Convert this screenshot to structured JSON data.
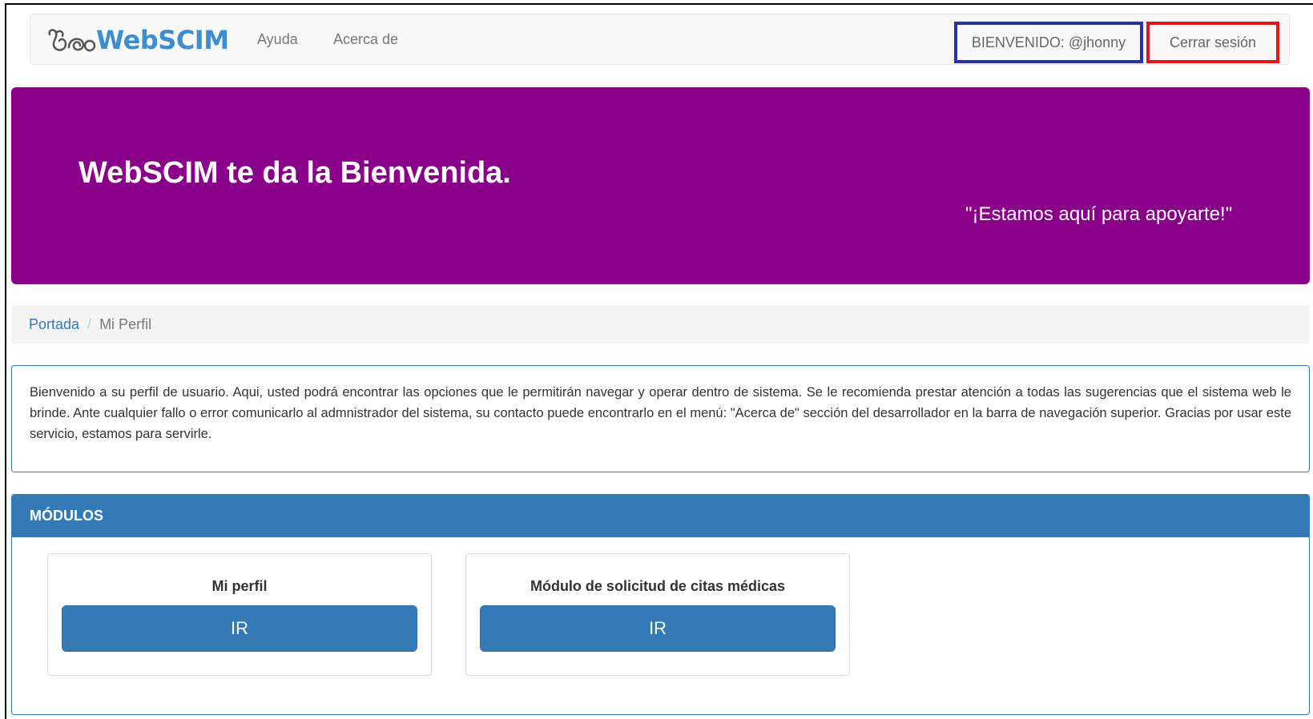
{
  "navbar": {
    "brand": "WebSCIM",
    "brand_icon": "stethoscope-logo-icon",
    "links": [
      "Ayuda",
      "Acerca de"
    ],
    "welcome_text": "BIENVENIDO: @jhonny",
    "logout_label": "Cerrar sesión"
  },
  "jumbotron": {
    "title": "WebSCIM te da la Bienvenida.",
    "subtitle": "\"¡Estamos aquí para apoyarte!\"",
    "background_color": "#8b008b"
  },
  "breadcrumb": {
    "home": "Portada",
    "separator": "/",
    "current": "Mi Perfil"
  },
  "info": {
    "text": "Bienvenido a su perfil de usuario. Aqui, usted podrá encontrar las opciones que le permitirán navegar y operar dentro de sistema. Se le recomienda prestar atención a todas las sugerencias que el sistema web le brinde. Ante cualquier fallo o error comunicarlo al admnistrador del sistema, su contacto puede encontrarlo en el menú: \"Acerca de\" sección del desarrollador en la barra de navegación superior. Gracias por usar este servicio, estamos para servirle."
  },
  "modules": {
    "heading": "MÓDULOS",
    "cards": [
      {
        "title": "Mi perfil",
        "button": "IR"
      },
      {
        "title": "Módulo de solicitud de citas médicas",
        "button": "IR"
      }
    ]
  },
  "colors": {
    "primary": "#337ab7",
    "brand": "#3d8dd1",
    "highlight_blue": "#2b2fa9",
    "highlight_red": "#e0161b"
  }
}
